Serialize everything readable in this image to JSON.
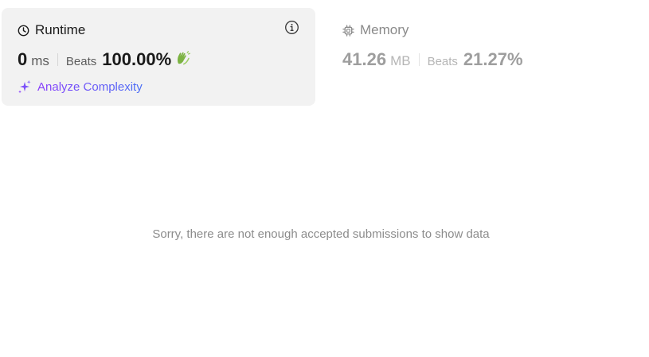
{
  "runtime": {
    "title": "Runtime",
    "value": "0",
    "unit": "ms",
    "beats_label": "Beats",
    "beats_percent": "100.00%",
    "icon": "clock-icon",
    "info_icon": "info-icon",
    "badge_icon": "clapping-hands-icon",
    "analyze_label": "Analyze Complexity",
    "analyze_icon": "sparkles-icon"
  },
  "memory": {
    "title": "Memory",
    "value": "41.26",
    "unit": "MB",
    "beats_label": "Beats",
    "beats_percent": "21.27%",
    "icon": "chip-icon"
  },
  "chart": {
    "empty_message": "Sorry, there are not enough accepted submissions to show data"
  },
  "colors": {
    "card_background": "#f2f2f2",
    "accent_purple": "#8a3ffc",
    "accent_blue": "#4a6ef5",
    "badge_green": "#7cb342"
  }
}
